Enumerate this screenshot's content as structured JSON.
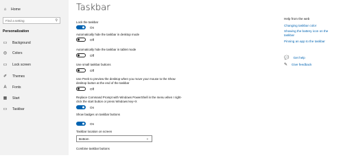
{
  "sidebar": {
    "home": {
      "icon": "home-icon",
      "label": "Home"
    },
    "search_placeholder": "Find a setting",
    "heading": "Personalization",
    "items": [
      {
        "icon": "background-icon",
        "label": "Background"
      },
      {
        "icon": "colors-icon",
        "label": "Colors"
      },
      {
        "icon": "lock-screen-icon",
        "label": "Lock screen"
      },
      {
        "icon": "themes-icon",
        "label": "Themes"
      },
      {
        "icon": "fonts-icon",
        "label": "Fonts"
      },
      {
        "icon": "start-icon",
        "label": "Start"
      },
      {
        "icon": "taskbar-icon",
        "label": "Taskbar"
      }
    ]
  },
  "main": {
    "title": "Taskbar",
    "settings": [
      {
        "label": "Lock the taskbar",
        "state": "On",
        "on": true
      },
      {
        "label": "Automatically hide the taskbar in desktop mode",
        "state": "Off",
        "on": false
      },
      {
        "label": "Automatically hide the taskbar in tablet mode",
        "state": "Off",
        "on": false
      },
      {
        "label": "Use small taskbar buttons",
        "state": "Off",
        "on": false
      },
      {
        "label": "Use Peek to preview the desktop when you move your mouse to the Show desktop button at the end of the taskbar",
        "state": "Off",
        "on": false
      },
      {
        "label": "Replace Command Prompt with Windows PowerShell in the menu when I right-click the start button or press Windows key+X",
        "state": "On",
        "on": true
      },
      {
        "label": "Show badges on taskbar buttons",
        "state": "On",
        "on": true
      }
    ],
    "location_label": "Taskbar location on screen",
    "location_value": "Bottom",
    "combine_label": "Combine taskbar buttons"
  },
  "help": {
    "heading": "Help from the web",
    "links": [
      "Changing taskbar color",
      "Showing the battery icon on the taskbar",
      "Pinning an app to the taskbar"
    ],
    "get_help": "Get help",
    "give_feedback": "Give feedback"
  },
  "colors": {
    "accent": "#0063b1",
    "sidebar_bg": "#f2f2f2"
  }
}
